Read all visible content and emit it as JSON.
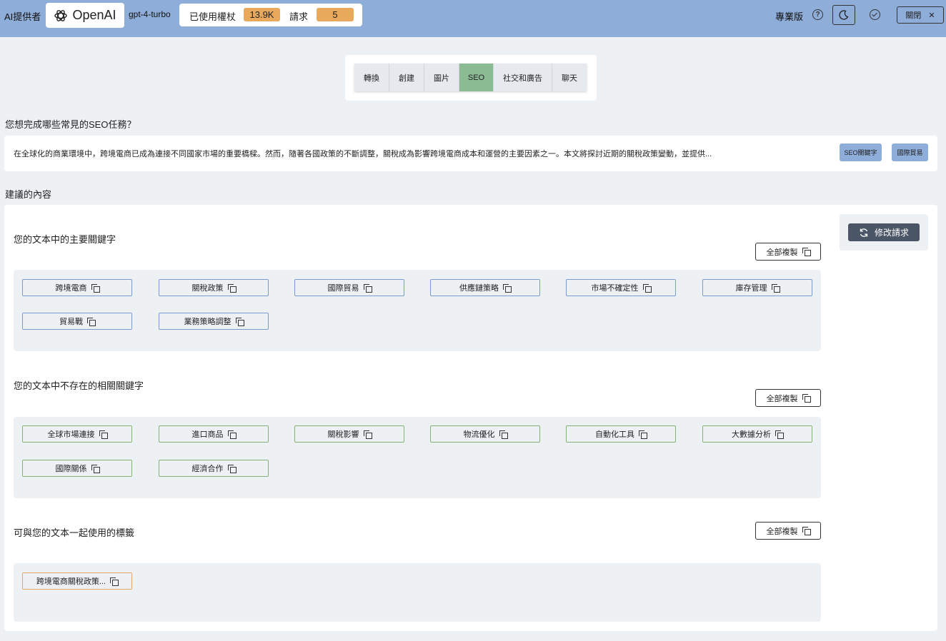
{
  "topbar": {
    "provider_label": "AI提供者",
    "provider_name": "OpenAI",
    "model": "gpt-4-turbo",
    "usage_label": "已使用權杖",
    "usage_value": "13.9K",
    "requests_label": "請求",
    "requests_value": "5",
    "pro_label": "專業版",
    "help_icon": "?",
    "close_label": "關閉"
  },
  "tabs": [
    {
      "label": "轉換",
      "active": false
    },
    {
      "label": "創建",
      "active": false
    },
    {
      "label": "圖片",
      "active": false
    },
    {
      "label": "SEO",
      "active": true
    },
    {
      "label": "社交和廣告",
      "active": false
    },
    {
      "label": "聊天",
      "active": false
    }
  ],
  "question": "您想完成哪些常見的SEO任務？",
  "input": {
    "text": "在全球化的商業環境中，跨境電商已成為連接不同國家市場的重要橋樑。然而，隨著各國政策的不斷調整，關稅成為影響跨境電商成本和運營的主要因素之一。本文將探討近期的關稅政策變動，並提供...",
    "chips": [
      "SEO關鍵字",
      "國際貿易"
    ]
  },
  "suggested_title": "建議的內容",
  "modify_label": "修改請求",
  "copy_all_label": "全部複製",
  "groups": {
    "main": {
      "title": "您的文本中的主要關鍵字",
      "keywords": [
        "跨境電商",
        "關稅政策",
        "國際貿易",
        "供應鏈策略",
        "市場不確定性",
        "庫存管理",
        "貿易戰",
        "業務策略調整"
      ]
    },
    "related": {
      "title": "您的文本中不存在的相關關鍵字",
      "keywords": [
        "全球市場連接",
        "進口商品",
        "關稅影響",
        "物流優化",
        "自動化工具",
        "大數據分析",
        "國際關係",
        "經濟合作"
      ]
    },
    "tags": {
      "title": "可與您的文本一起使用的標籤",
      "keywords": [
        "跨境電商關稅政策..."
      ]
    }
  },
  "colors": {
    "topbar": "#8fadd9",
    "active_tab": "#8bbb93",
    "badge": "#e8a95d",
    "main_border": "#7a9bd1",
    "related_border": "#86b07a",
    "tag_border": "#e0a66a"
  }
}
